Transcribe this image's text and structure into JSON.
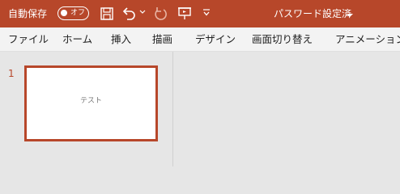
{
  "titlebar": {
    "autosave_label": "自動保存",
    "autosave_state": "オフ",
    "document_title": "パスワード設定済"
  },
  "ribbon": {
    "tabs": [
      {
        "label": "ファイル"
      },
      {
        "label": "ホーム"
      },
      {
        "label": "挿入"
      },
      {
        "label": "描画"
      },
      {
        "label": "デザイン"
      },
      {
        "label": "画面切り替え"
      },
      {
        "label": "アニメーション"
      }
    ]
  },
  "slides": [
    {
      "number": "1",
      "text": "テスト"
    }
  ],
  "colors": {
    "accent": "#b7472a",
    "ribbon_bg": "#f3f3f3",
    "workspace_bg": "#e6e6e6"
  },
  "icons": [
    "save-icon",
    "undo-icon",
    "redo-icon",
    "present-icon",
    "customize-qat-icon",
    "chevron-down-icon"
  ]
}
